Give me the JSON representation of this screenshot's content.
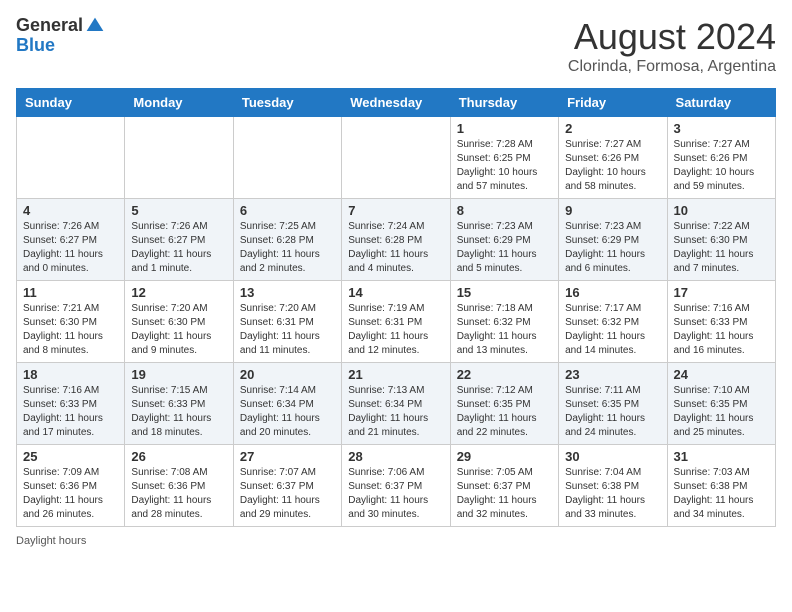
{
  "header": {
    "logo_general": "General",
    "logo_blue": "Blue",
    "month_year": "August 2024",
    "location": "Clorinda, Formosa, Argentina"
  },
  "days_of_week": [
    "Sunday",
    "Monday",
    "Tuesday",
    "Wednesday",
    "Thursday",
    "Friday",
    "Saturday"
  ],
  "weeks": [
    [
      {
        "day": "",
        "info": ""
      },
      {
        "day": "",
        "info": ""
      },
      {
        "day": "",
        "info": ""
      },
      {
        "day": "",
        "info": ""
      },
      {
        "day": "1",
        "info": "Sunrise: 7:28 AM\nSunset: 6:25 PM\nDaylight: 10 hours and 57 minutes."
      },
      {
        "day": "2",
        "info": "Sunrise: 7:27 AM\nSunset: 6:26 PM\nDaylight: 10 hours and 58 minutes."
      },
      {
        "day": "3",
        "info": "Sunrise: 7:27 AM\nSunset: 6:26 PM\nDaylight: 10 hours and 59 minutes."
      }
    ],
    [
      {
        "day": "4",
        "info": "Sunrise: 7:26 AM\nSunset: 6:27 PM\nDaylight: 11 hours and 0 minutes."
      },
      {
        "day": "5",
        "info": "Sunrise: 7:26 AM\nSunset: 6:27 PM\nDaylight: 11 hours and 1 minute."
      },
      {
        "day": "6",
        "info": "Sunrise: 7:25 AM\nSunset: 6:28 PM\nDaylight: 11 hours and 2 minutes."
      },
      {
        "day": "7",
        "info": "Sunrise: 7:24 AM\nSunset: 6:28 PM\nDaylight: 11 hours and 4 minutes."
      },
      {
        "day": "8",
        "info": "Sunrise: 7:23 AM\nSunset: 6:29 PM\nDaylight: 11 hours and 5 minutes."
      },
      {
        "day": "9",
        "info": "Sunrise: 7:23 AM\nSunset: 6:29 PM\nDaylight: 11 hours and 6 minutes."
      },
      {
        "day": "10",
        "info": "Sunrise: 7:22 AM\nSunset: 6:30 PM\nDaylight: 11 hours and 7 minutes."
      }
    ],
    [
      {
        "day": "11",
        "info": "Sunrise: 7:21 AM\nSunset: 6:30 PM\nDaylight: 11 hours and 8 minutes."
      },
      {
        "day": "12",
        "info": "Sunrise: 7:20 AM\nSunset: 6:30 PM\nDaylight: 11 hours and 9 minutes."
      },
      {
        "day": "13",
        "info": "Sunrise: 7:20 AM\nSunset: 6:31 PM\nDaylight: 11 hours and 11 minutes."
      },
      {
        "day": "14",
        "info": "Sunrise: 7:19 AM\nSunset: 6:31 PM\nDaylight: 11 hours and 12 minutes."
      },
      {
        "day": "15",
        "info": "Sunrise: 7:18 AM\nSunset: 6:32 PM\nDaylight: 11 hours and 13 minutes."
      },
      {
        "day": "16",
        "info": "Sunrise: 7:17 AM\nSunset: 6:32 PM\nDaylight: 11 hours and 14 minutes."
      },
      {
        "day": "17",
        "info": "Sunrise: 7:16 AM\nSunset: 6:33 PM\nDaylight: 11 hours and 16 minutes."
      }
    ],
    [
      {
        "day": "18",
        "info": "Sunrise: 7:16 AM\nSunset: 6:33 PM\nDaylight: 11 hours and 17 minutes."
      },
      {
        "day": "19",
        "info": "Sunrise: 7:15 AM\nSunset: 6:33 PM\nDaylight: 11 hours and 18 minutes."
      },
      {
        "day": "20",
        "info": "Sunrise: 7:14 AM\nSunset: 6:34 PM\nDaylight: 11 hours and 20 minutes."
      },
      {
        "day": "21",
        "info": "Sunrise: 7:13 AM\nSunset: 6:34 PM\nDaylight: 11 hours and 21 minutes."
      },
      {
        "day": "22",
        "info": "Sunrise: 7:12 AM\nSunset: 6:35 PM\nDaylight: 11 hours and 22 minutes."
      },
      {
        "day": "23",
        "info": "Sunrise: 7:11 AM\nSunset: 6:35 PM\nDaylight: 11 hours and 24 minutes."
      },
      {
        "day": "24",
        "info": "Sunrise: 7:10 AM\nSunset: 6:35 PM\nDaylight: 11 hours and 25 minutes."
      }
    ],
    [
      {
        "day": "25",
        "info": "Sunrise: 7:09 AM\nSunset: 6:36 PM\nDaylight: 11 hours and 26 minutes."
      },
      {
        "day": "26",
        "info": "Sunrise: 7:08 AM\nSunset: 6:36 PM\nDaylight: 11 hours and 28 minutes."
      },
      {
        "day": "27",
        "info": "Sunrise: 7:07 AM\nSunset: 6:37 PM\nDaylight: 11 hours and 29 minutes."
      },
      {
        "day": "28",
        "info": "Sunrise: 7:06 AM\nSunset: 6:37 PM\nDaylight: 11 hours and 30 minutes."
      },
      {
        "day": "29",
        "info": "Sunrise: 7:05 AM\nSunset: 6:37 PM\nDaylight: 11 hours and 32 minutes."
      },
      {
        "day": "30",
        "info": "Sunrise: 7:04 AM\nSunset: 6:38 PM\nDaylight: 11 hours and 33 minutes."
      },
      {
        "day": "31",
        "info": "Sunrise: 7:03 AM\nSunset: 6:38 PM\nDaylight: 11 hours and 34 minutes."
      }
    ]
  ],
  "footer": {
    "daylight_label": "Daylight hours"
  }
}
